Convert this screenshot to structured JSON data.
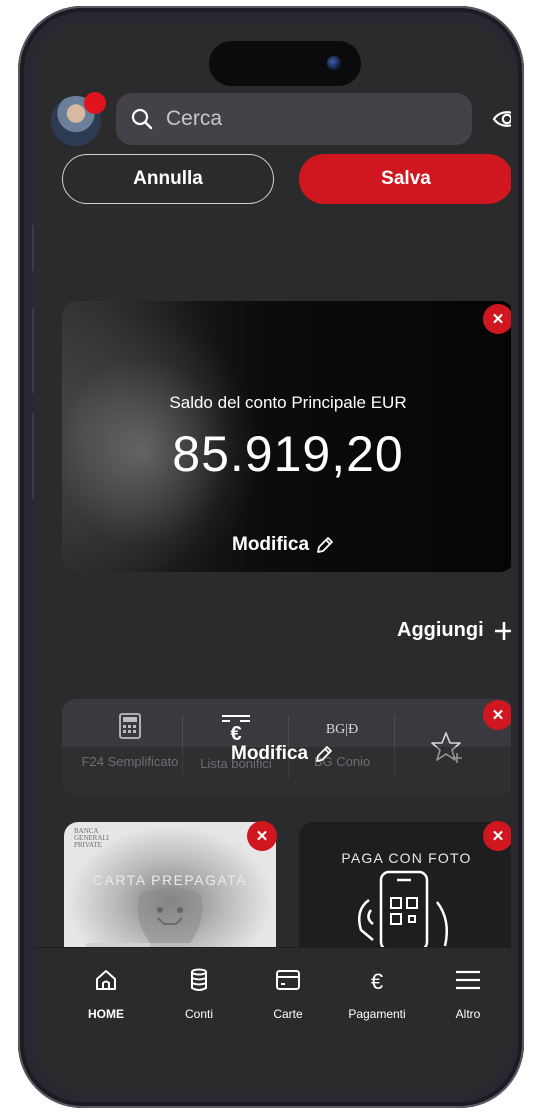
{
  "header": {
    "search_placeholder": "Cerca"
  },
  "actions": {
    "cancel_label": "Annulla",
    "save_label": "Salva"
  },
  "balance_widget": {
    "label": "Saldo del conto Principale EUR",
    "amount": "85.919,20",
    "edit_label": "Modifica"
  },
  "add_widget_label": "Aggiungi",
  "shortcuts": {
    "items": [
      {
        "label": "F24 Semplificato",
        "icon": "f24-calculator-icon"
      },
      {
        "label": "Lista bonifici",
        "icon": "euro-list-icon"
      },
      {
        "label": "BG Conio",
        "icon": "bg-conio-logo-icon"
      },
      {
        "label": "",
        "icon": "add-favorite-star-icon"
      }
    ],
    "edit_label": "Modifica"
  },
  "cards": [
    {
      "title": "CARTA PREPAGATA",
      "logo_text": "BANCA GENERALI PRIVATE"
    },
    {
      "title": "PAGA CON FOTO"
    }
  ],
  "bottom_nav": {
    "items": [
      {
        "label": "HOME",
        "icon": "home-icon",
        "active": true
      },
      {
        "label": "Conti",
        "icon": "coins-icon",
        "active": false
      },
      {
        "label": "Carte",
        "icon": "card-icon",
        "active": false
      },
      {
        "label": "Pagamenti",
        "icon": "euro-icon",
        "active": false
      },
      {
        "label": "Altro",
        "icon": "menu-icon",
        "active": false
      }
    ]
  },
  "colors": {
    "accent": "#d0171f",
    "background": "#2b2a2c",
    "surface": "#3a393d"
  }
}
